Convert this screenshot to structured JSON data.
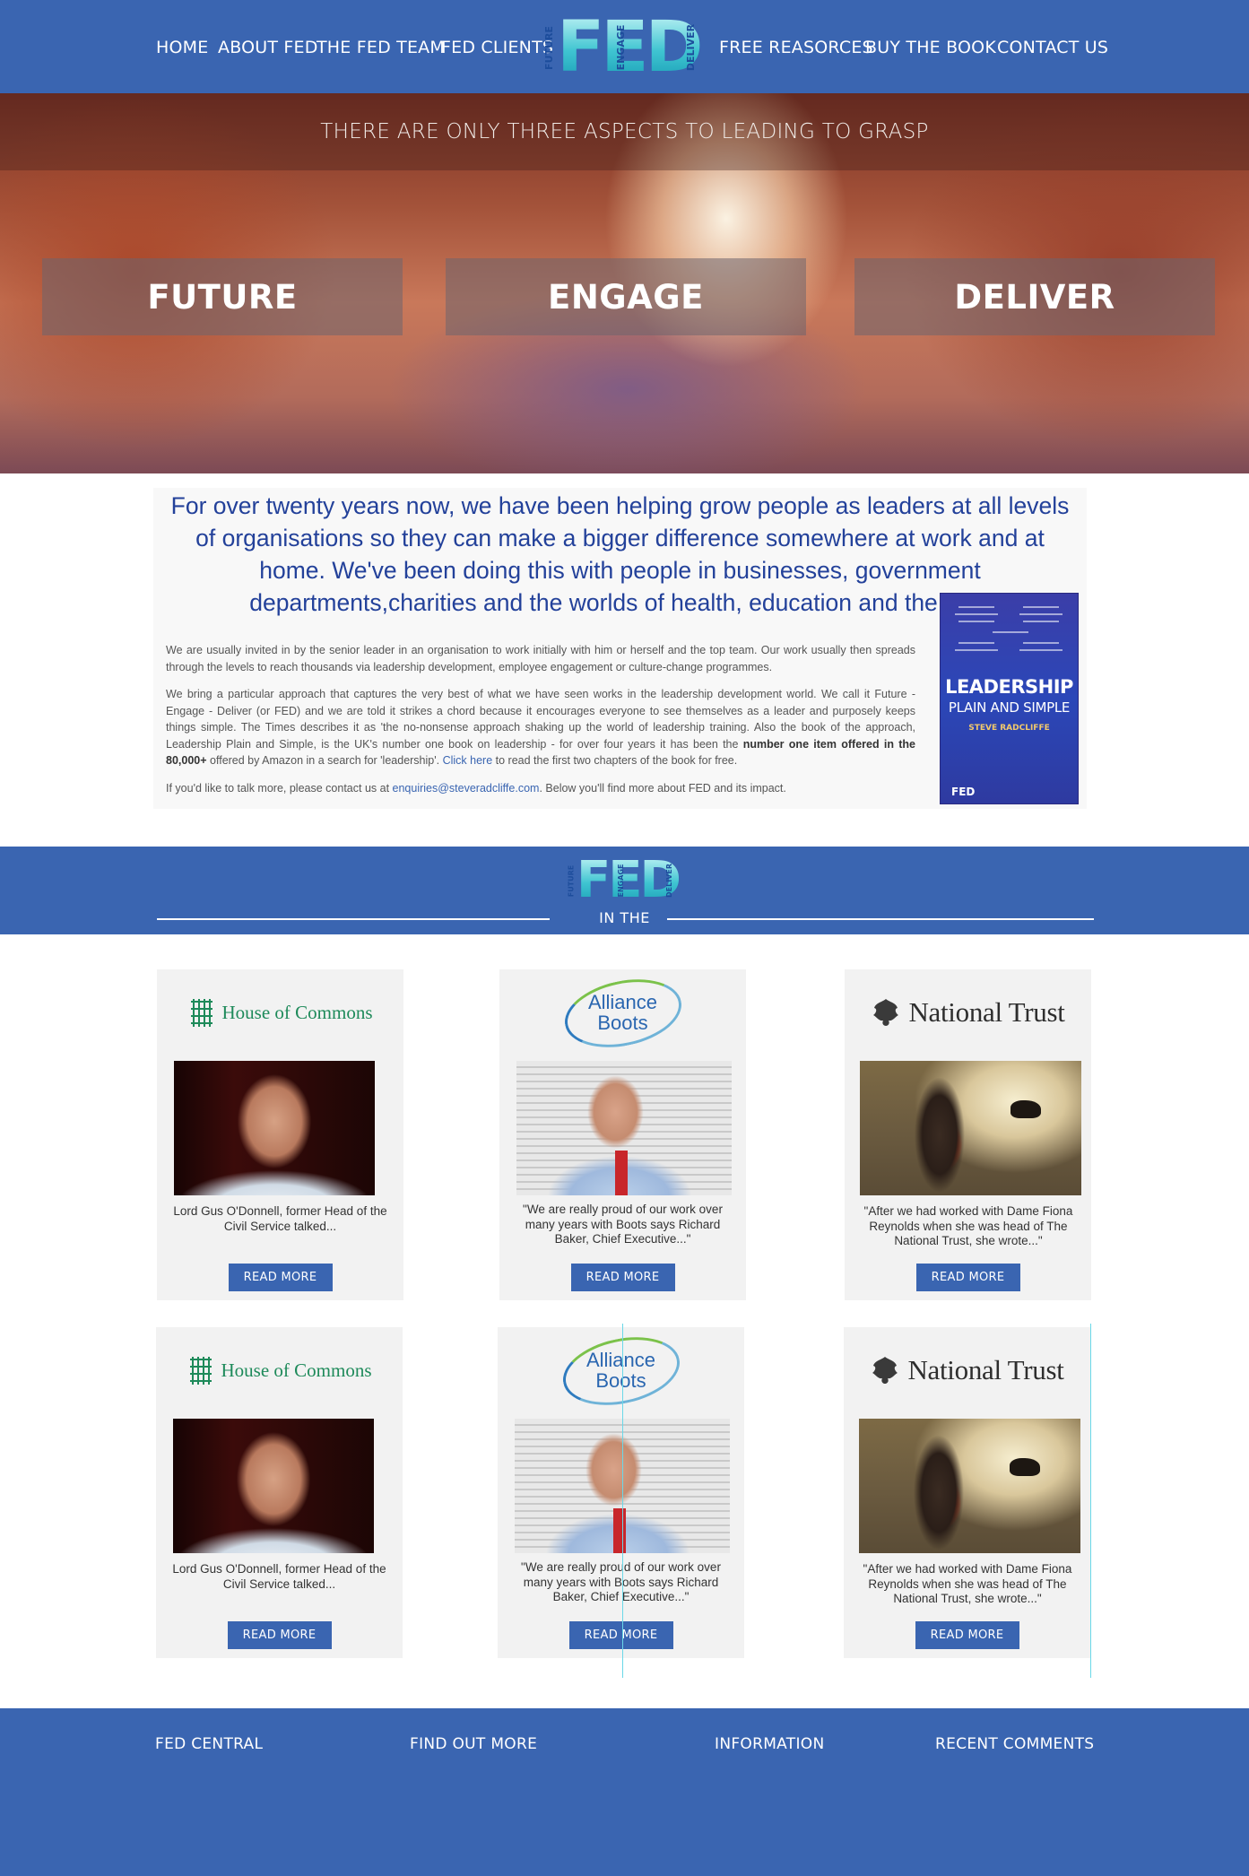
{
  "nav": {
    "left": [
      "HOME",
      "ABOUT FED",
      "THE FED TEAM",
      "FED CLIENTS"
    ],
    "right": [
      "FREE REASORCES",
      "BUY THE BOOK",
      "CONTACT US"
    ],
    "logo": {
      "small": [
        "FUTURE",
        "ENGAGE",
        "DELIVER"
      ],
      "big": "FED"
    }
  },
  "hero": {
    "tagline": "THERE ARE ONLY THREE ASPECTS TO LEADING TO GRASP",
    "panels": [
      "FUTURE",
      "ENGAGE",
      "DELIVER"
    ]
  },
  "intro": {
    "lead": "For over twenty years now, we have been helping grow people as leaders at all levels of organisations so they can make a bigger difference somewhere at work and at home. We've been doing this with people in businesses, government departments,charities and the worlds of health, education and the arts.",
    "p1": "We are usually invited in by the senior leader in an organisation to work initially with him or herself and the top team. Our work usually then spreads through the levels to reach thousands via leadership development, employee engagement or culture-change programmes.",
    "p2_a": "We bring a particular approach that captures the very best of what we have seen works in the leadership development world. We call it Future - Engage - Deliver (or FED) and we are told it strikes a chord because it encourages everyone to see themselves as a leader and purposely keeps things simple. The Times describes it as 'the no-nonsense approach shaking up the world of leadership training. Also the book of the approach, Leadership Plain and Simple, is the UK's number one book on leadership - for over four years it has been the ",
    "p2_bold": "number one item offered in the 80,000+",
    "p2_b": " offered by Amazon in a search for 'leadership'. ",
    "p2_link": "Click here",
    "p2_c": " to read the first two chapters of the book for free.",
    "p3_a": "If you'd like to talk more, please contact us at ",
    "p3_email": "enquiries@steveradcliffe.com",
    "p3_b": ". Below you'll find more about FED and its impact.",
    "book": {
      "title": "LEADERSHIP",
      "subtitle": "PLAIN AND SIMPLE",
      "author": "STEVE RADCLIFFE",
      "badge": "FED"
    }
  },
  "inthe": {
    "logo": {
      "small": [
        "FUTURE",
        "ENGAGE",
        "DELIVER"
      ],
      "big": "FED"
    },
    "label": "IN THE"
  },
  "cards": [
    {
      "brand": "House of Commons",
      "caption": "Lord Gus O'Donnell, former Head of the Civil Service talked...",
      "button": "READ MORE"
    },
    {
      "brand_lines": [
        "Alliance",
        "Boots"
      ],
      "caption": "\"We are really proud of our work over many years with Boots says Richard Baker, Chief Executive...\"",
      "button": "READ MORE"
    },
    {
      "brand": "National Trust",
      "caption": "\"After we had worked with Dame Fiona Reynolds when she was head of The National Trust, she wrote...\"",
      "button": "READ MORE"
    },
    {
      "brand": "House of Commons",
      "caption": "Lord Gus O'Donnell, former Head of the Civil Service talked...",
      "button": "READ MORE"
    },
    {
      "brand_lines": [
        "Alliance",
        "Boots"
      ],
      "caption": "\"We are really proud of our work over many years with Boots says Richard Baker, Chief Executive...\"",
      "button": "READ MORE"
    },
    {
      "brand": "National Trust",
      "caption": "\"After we had worked with Dame Fiona Reynolds when she was head of The National Trust, she wrote...\"",
      "button": "READ MORE"
    }
  ],
  "footer": {
    "headings": [
      "FED CENTRAL",
      "FIND OUT MORE",
      "INFORMATION",
      "RECENT COMMENTS"
    ]
  },
  "colors": {
    "brand_blue": "#3a65b1",
    "lead_text": "#23419a",
    "logo_teal": "#24b5c9"
  }
}
